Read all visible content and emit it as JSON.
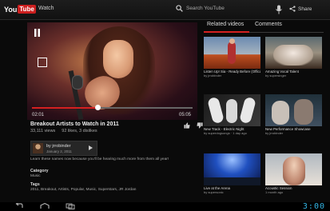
{
  "topbar": {
    "logo_you": "You",
    "logo_tube": "Tube",
    "title": "Watch",
    "search_label": "Search YouTube",
    "share_label": "Share"
  },
  "player": {
    "current_time": "02:01",
    "total_time": "05:05",
    "progress": 0.41
  },
  "video": {
    "title": "Breakout Artists to Watch in 2011",
    "views": "33,111 views",
    "likes": "92 likes, 3 dislikes",
    "uploader_name": "by jrrobinder",
    "uploader_date": "January 2, 2011",
    "description": "Learn these names now because you'll be hearing much more from them all year!",
    "category_label": "Category",
    "category_value": "Music",
    "tags_label": "Tags",
    "tags_value": "2011, Breakout, Artists, Popular, Music, Superstars, JR Jordan"
  },
  "sidebar": {
    "tabs": [
      "Related videos",
      "Comments"
    ],
    "cards": [
      {
        "title": "Listen Up! Sia - Ready Before (Official video)",
        "sub": "by jrrobinder"
      },
      {
        "title": "Amazing Vocal Talent",
        "sub": "by supersinger"
      },
      {
        "title": "New Track - Electric Night",
        "sub": "by superdogsongs · 1 day ago"
      },
      {
        "title": "New Performance Showcase",
        "sub": "by jrrobinder"
      },
      {
        "title": "Live at the Arena",
        "sub": "by supersonic"
      },
      {
        "title": "Acoustic Session",
        "sub": "1 month ago"
      }
    ]
  },
  "statusbar": {
    "clock": "3:00"
  }
}
